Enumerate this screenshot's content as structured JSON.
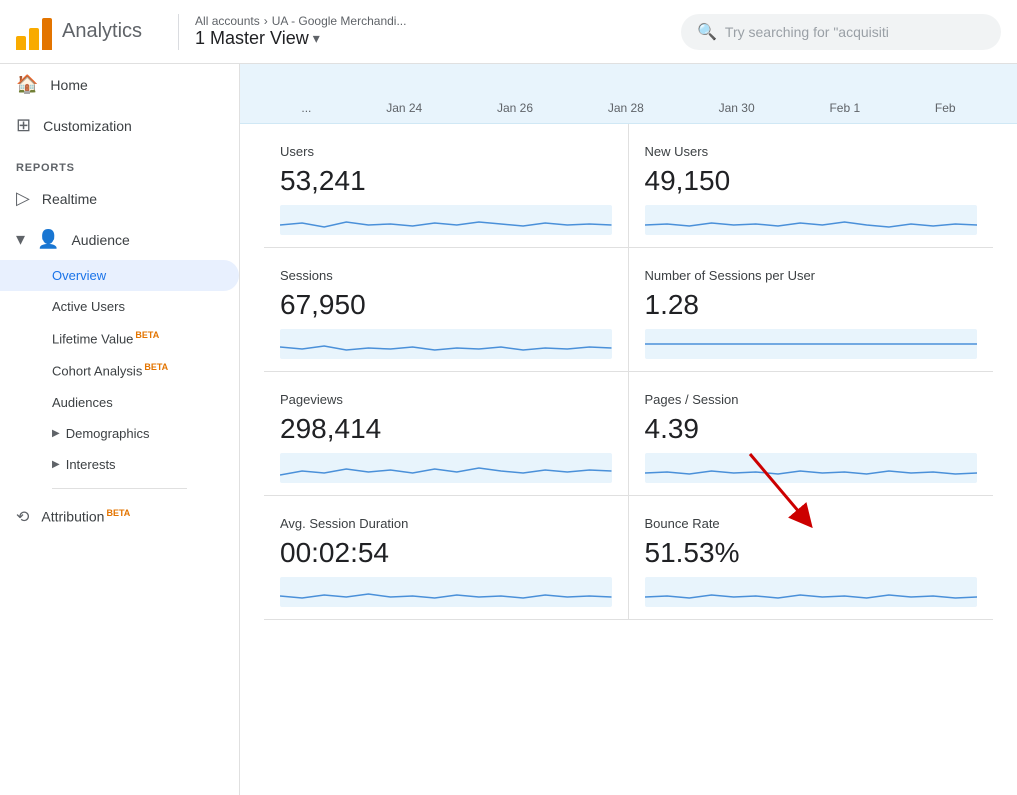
{
  "header": {
    "logo_text": "Analytics",
    "breadcrumb": {
      "all_accounts": "All accounts",
      "separator": "›",
      "current": "UA - Google Merchandi..."
    },
    "view": "1 Master View",
    "dropdown_symbol": "▾",
    "search_placeholder": "Try searching for \"acquisiti"
  },
  "sidebar": {
    "home_label": "Home",
    "customization_label": "Customization",
    "reports_section": "REPORTS",
    "realtime_label": "Realtime",
    "audience_label": "Audience",
    "audience_submenu": [
      {
        "label": "Overview",
        "active": true
      },
      {
        "label": "Active Users"
      },
      {
        "label": "Lifetime Value",
        "beta": "BETA"
      },
      {
        "label": "Cohort Analysis",
        "beta": "BETA"
      },
      {
        "label": "Audiences"
      },
      {
        "label": "Demographics",
        "expandable": true
      },
      {
        "label": "Interests",
        "expandable": true
      }
    ],
    "attribution_label": "Attribution",
    "attribution_beta": "BETA"
  },
  "chart": {
    "dates": [
      "...",
      "Jan 24",
      "Jan 26",
      "Jan 28",
      "Jan 30",
      "Feb 1",
      "Feb..."
    ]
  },
  "metrics": [
    {
      "label": "Users",
      "value": "53,241"
    },
    {
      "label": "New Users",
      "value": "49,150"
    },
    {
      "label": "Sessions",
      "value": "67,950"
    },
    {
      "label": "Number of Sessions per User",
      "value": "1.28"
    },
    {
      "label": "Pageviews",
      "value": "298,414"
    },
    {
      "label": "Pages / Session",
      "value": "4.39"
    },
    {
      "label": "Avg. Session Duration",
      "value": "00:02:54"
    },
    {
      "label": "Bounce Rate",
      "value": "51.53%"
    }
  ]
}
